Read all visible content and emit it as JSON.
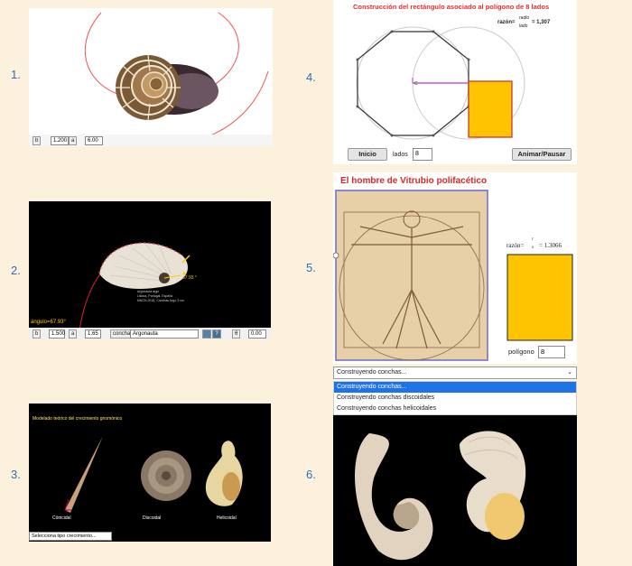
{
  "numbers": [
    "1.",
    "2.",
    "3.",
    "4.",
    "5.",
    "6."
  ],
  "p1": {
    "b_label": "b",
    "b_value": "1.200",
    "a_label": "a",
    "a_value": "6.00"
  },
  "p2": {
    "angle_label": "ángulo=67.93°",
    "small_angle": "67.93 °",
    "info_lines": [
      "Argonauta argo",
      "Lisboa, Portugal, España",
      "MNCN 2015, Conchas Argo 3 cm"
    ],
    "b_label": "b",
    "b_value": "1.500",
    "a_label": "a",
    "a_value": "1.65",
    "concha_label": "concha",
    "concha_value": "Argonauta",
    "help_label": "?",
    "theta_label": "θ",
    "theta_value": "0.00"
  },
  "p3": {
    "title": "Modelado teórico del crecimiento gnomónico",
    "labels": [
      "Cónicidal",
      "Discoidal",
      "Helicoidal"
    ],
    "select_value": "Selecciona tipo crecimiento..."
  },
  "p4": {
    "title": "Construcción del rectángulo asociado al polígono de 8 lados",
    "ratio_prefix": "razón=",
    "ratio_num": "radio",
    "ratio_den": "lado",
    "ratio_value": "= 1,307",
    "center_label": "C",
    "inicio": "Inicio",
    "lados": "lados",
    "lados_value": "8",
    "animar": "Animar/Pausar"
  },
  "p5": {
    "title": "El hombre de Vitrubio polifacético",
    "ratio_label": "razón=",
    "ratio_num": "r",
    "ratio_den": "s",
    "ratio_value": "= 1.3066",
    "poligono_label": "polígono",
    "poligono_value": "8"
  },
  "p6": {
    "select_value": "Construyendo conchas...",
    "options": [
      "Construyendo conchas...",
      "Construyendo conchas discoidales",
      "Construyendo conchas helicoidales"
    ]
  },
  "colors": {
    "link_blue": "#2f6fb5",
    "accent_red": "#d32f2f",
    "yellow": "#ffc400",
    "selected_blue": "#1e73e8"
  }
}
